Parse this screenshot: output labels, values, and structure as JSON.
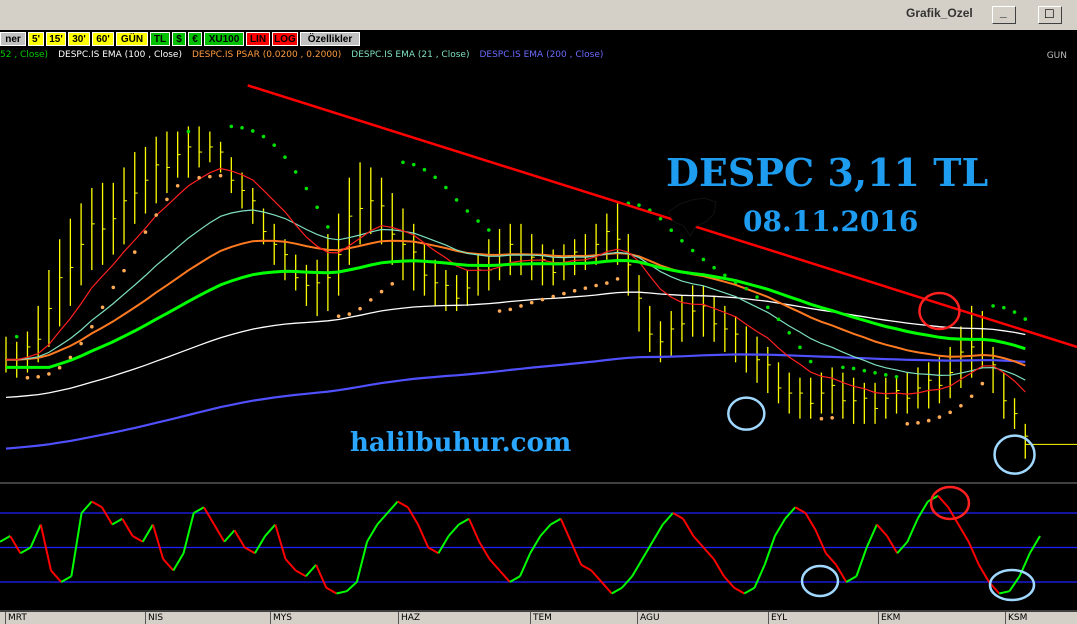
{
  "window": {
    "title": "Grafik_Ozel",
    "minimize_label": "_",
    "maximize_label": "☐"
  },
  "toolbar": {
    "buttons": [
      {
        "label": "ner",
        "bg": "#c0c0c0",
        "fg": "#000"
      },
      {
        "label": "5'",
        "bg": "#ffff00",
        "fg": "#000"
      },
      {
        "label": "15'",
        "bg": "#ffff00",
        "fg": "#000"
      },
      {
        "label": "30'",
        "bg": "#ffff00",
        "fg": "#000"
      },
      {
        "label": "60'",
        "bg": "#ffff00",
        "fg": "#000"
      },
      {
        "label": "GÜN",
        "bg": "#ffff00",
        "fg": "#000"
      },
      {
        "label": "TL",
        "bg": "#00c000",
        "fg": "#000"
      },
      {
        "label": "$",
        "bg": "#00c000",
        "fg": "#000"
      },
      {
        "label": "€",
        "bg": "#00c000",
        "fg": "#000"
      },
      {
        "label": "XU100",
        "bg": "#00c000",
        "fg": "#000"
      },
      {
        "label": "LIN",
        "bg": "#ff0000",
        "fg": "#000"
      },
      {
        "label": "LOG",
        "bg": "#ff0000",
        "fg": "#000"
      },
      {
        "label": "Özellikler",
        "bg": "#c0c0c0",
        "fg": "#000"
      }
    ]
  },
  "legend": [
    {
      "text": "52 , Close)",
      "color": "#00cc00"
    },
    {
      "text": "DESPC.IS EMA (100 , Close)",
      "color": "#ffffff"
    },
    {
      "text": "DESPC.IS PSAR (0.0200 , 0.2000)",
      "color": "#ff9a3c"
    },
    {
      "text": "DESPC.IS EMA (21 , Close)",
      "color": "#7fe0c0"
    },
    {
      "text": "DESPC.IS EMA (200 , Close)",
      "color": "#6a6aff"
    }
  ],
  "period_label": "GUN",
  "annotations": {
    "title": "DESPC 3,11 TL",
    "date": "08.11.2016",
    "watermark": "halilbuhur.com"
  },
  "colors": {
    "price_bars": "#ffff00",
    "ema_fast": "#00ff00",
    "ema_100": "#ffffff",
    "ema_21": "#7fe0c0",
    "ema_200": "#5050ff",
    "ema_short_red": "#ff2020",
    "ema_orange": "#ff7a20",
    "psar": "#ffaa55",
    "trendline": "#ff0000",
    "annotation_text": "#1e9cf0",
    "osc_up": "#00ff00",
    "osc_down": "#ff0000",
    "osc_levels": "#2020ff",
    "circle_red": "#ff2020",
    "circle_blue": "#a0d8ff"
  },
  "chart_data": {
    "type": "line",
    "x_labels": [
      "MRT",
      "NIS",
      "MYS",
      "HAZ",
      "TEM",
      "AGU",
      "EYL",
      "EKM",
      "KSM"
    ],
    "price_bars": [
      [
        3.95,
        4.3
      ],
      [
        3.9,
        4.25
      ],
      [
        3.95,
        4.35
      ],
      [
        4.05,
        4.6
      ],
      [
        4.2,
        4.95
      ],
      [
        4.4,
        5.25
      ],
      [
        4.6,
        5.45
      ],
      [
        4.8,
        5.6
      ],
      [
        4.95,
        5.75
      ],
      [
        5.0,
        5.8
      ],
      [
        5.1,
        5.8
      ],
      [
        5.2,
        5.95
      ],
      [
        5.4,
        6.1
      ],
      [
        5.5,
        6.15
      ],
      [
        5.6,
        6.25
      ],
      [
        5.7,
        6.3
      ],
      [
        5.85,
        6.3
      ],
      [
        5.85,
        6.35
      ],
      [
        5.95,
        6.35
      ],
      [
        6.0,
        6.3
      ],
      [
        5.9,
        6.2
      ],
      [
        5.7,
        6.05
      ],
      [
        5.55,
        5.9
      ],
      [
        5.4,
        5.75
      ],
      [
        5.2,
        5.55
      ],
      [
        5.0,
        5.4
      ],
      [
        4.85,
        5.25
      ],
      [
        4.75,
        5.1
      ],
      [
        4.6,
        5.0
      ],
      [
        4.5,
        5.05
      ],
      [
        4.55,
        5.3
      ],
      [
        4.7,
        5.5
      ],
      [
        5.0,
        5.85
      ],
      [
        5.2,
        6.0
      ],
      [
        5.3,
        5.95
      ],
      [
        5.2,
        5.85
      ],
      [
        5.0,
        5.7
      ],
      [
        4.85,
        5.55
      ],
      [
        4.75,
        5.4
      ],
      [
        4.7,
        5.2
      ],
      [
        4.6,
        5.05
      ],
      [
        4.55,
        4.95
      ],
      [
        4.55,
        4.9
      ],
      [
        4.6,
        4.95
      ],
      [
        4.7,
        5.1
      ],
      [
        4.75,
        5.25
      ],
      [
        4.85,
        5.35
      ],
      [
        4.9,
        5.4
      ],
      [
        4.9,
        5.4
      ],
      [
        4.85,
        5.3
      ],
      [
        4.8,
        5.2
      ],
      [
        4.8,
        5.15
      ],
      [
        4.85,
        5.2
      ],
      [
        4.9,
        5.25
      ],
      [
        4.95,
        5.3
      ],
      [
        5.0,
        5.4
      ],
      [
        5.05,
        5.5
      ],
      [
        5.0,
        5.6
      ],
      [
        4.7,
        5.3
      ],
      [
        4.35,
        4.9
      ],
      [
        4.15,
        4.6
      ],
      [
        4.05,
        4.45
      ],
      [
        4.1,
        4.55
      ],
      [
        4.25,
        4.7
      ],
      [
        4.3,
        4.8
      ],
      [
        4.3,
        4.8
      ],
      [
        4.25,
        4.7
      ],
      [
        4.15,
        4.6
      ],
      [
        4.05,
        4.5
      ],
      [
        3.95,
        4.4
      ],
      [
        3.85,
        4.3
      ],
      [
        3.75,
        4.2
      ],
      [
        3.65,
        4.05
      ],
      [
        3.55,
        3.95
      ],
      [
        3.5,
        3.9
      ],
      [
        3.5,
        3.9
      ],
      [
        3.55,
        3.95
      ],
      [
        3.55,
        4.0
      ],
      [
        3.5,
        3.95
      ],
      [
        3.45,
        3.9
      ],
      [
        3.45,
        3.85
      ],
      [
        3.45,
        3.85
      ],
      [
        3.5,
        3.9
      ],
      [
        3.55,
        3.9
      ],
      [
        3.55,
        3.95
      ],
      [
        3.6,
        4.0
      ],
      [
        3.6,
        4.05
      ],
      [
        3.65,
        4.1
      ],
      [
        3.7,
        4.2
      ],
      [
        3.8,
        4.4
      ],
      [
        3.9,
        4.6
      ],
      [
        4.0,
        4.55
      ],
      [
        3.75,
        4.2
      ],
      [
        3.5,
        3.95
      ],
      [
        3.4,
        3.7
      ],
      [
        3.11,
        3.45
      ]
    ],
    "trendline": {
      "start": [
        0.23,
        6.75
      ],
      "end": [
        1.0,
        4.2
      ]
    },
    "oscillator": {
      "levels": [
        80,
        50,
        20
      ],
      "ylim": [
        0,
        100
      ],
      "values": [
        55,
        60,
        45,
        50,
        70,
        30,
        20,
        25,
        80,
        90,
        85,
        70,
        75,
        60,
        55,
        70,
        40,
        30,
        45,
        80,
        85,
        70,
        55,
        65,
        50,
        45,
        60,
        70,
        40,
        30,
        25,
        35,
        15,
        10,
        12,
        20,
        55,
        70,
        80,
        90,
        85,
        70,
        50,
        45,
        60,
        70,
        75,
        55,
        40,
        30,
        20,
        25,
        45,
        60,
        70,
        75,
        55,
        35,
        30,
        20,
        10,
        15,
        25,
        40,
        55,
        70,
        80,
        75,
        60,
        50,
        40,
        25,
        15,
        10,
        15,
        35,
        60,
        75,
        85,
        80,
        65,
        45,
        35,
        20,
        25,
        50,
        70,
        60,
        45,
        55,
        75,
        90,
        95,
        85,
        70,
        55,
        35,
        20,
        10,
        12,
        25,
        45,
        60
      ]
    },
    "ylim": [
      3.0,
      6.9
    ]
  }
}
